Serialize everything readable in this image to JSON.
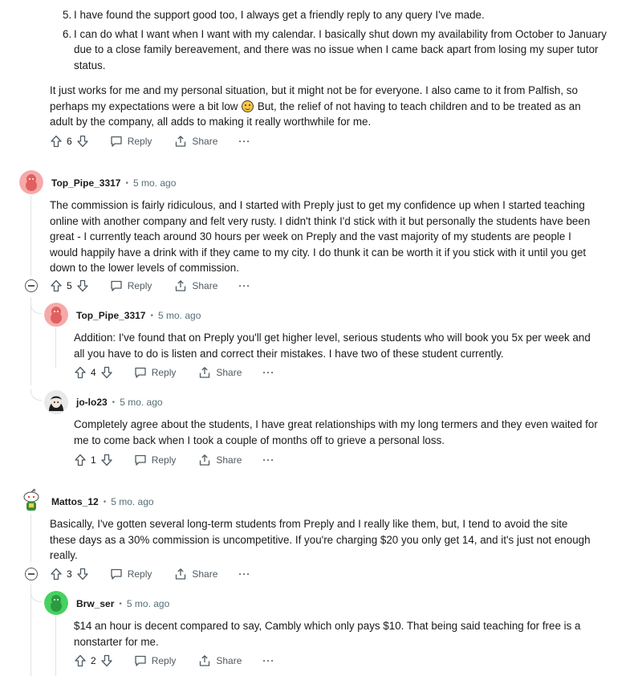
{
  "top_comment": {
    "list_items": [
      {
        "num": "5.",
        "text": "I have found the support good too, I always get a friendly reply to any query I've made."
      },
      {
        "num": "6.",
        "text": "I can do what I want when I want with my calendar. I basically shut down my availability from October to January due to a close family bereavement, and there was no issue when I came back apart from losing my super tutor status."
      }
    ],
    "para_before_emoji": "It just works for me and my personal situation, but it might not be for everyone. I also came to it from Palfish, so perhaps my expectations were a bit low ",
    "emoji_icon": "smiling-face-emoji",
    "para_after_emoji": " But, the relief of not having to teach children and to be treated as an adult by the company, all adds to making it really worthwhile for me.",
    "votes": "6"
  },
  "labels": {
    "reply": "Reply",
    "share": "Share",
    "more": "···",
    "separator": "•"
  },
  "comments": [
    {
      "author": "Top_Pipe_3317",
      "time": "5 mo. ago",
      "avatar_color": "#f08b8b",
      "text": "The commission is fairly ridiculous, and I started with Preply just to get my confidence up when I started teaching online with another company and felt very rusty. I didn't think I'd stick with it but personally the students have been great - I currently teach around 30 hours per week on Preply and the vast majority of my students are people I would happily have a drink with if they came to my city. I do thunk it can be worth it if you stick with it until you get down to the lower levels of commission.",
      "votes": "5"
    },
    {
      "author": "Top_Pipe_3317",
      "time": "5 mo. ago",
      "avatar_color": "#f08b8b",
      "text": "Addition: I've found that on Preply you'll get higher level, serious students who will book you 5x per week and all you have to do is listen and correct their mistakes. I have two of these student currently.",
      "votes": "4"
    },
    {
      "author": "jo-lo23",
      "time": "5 mo. ago",
      "avatar_color": "#222222",
      "text": "Completely agree about the students, I have great relationships with my long termers and they even waited for me to come back when I took a couple of months off to grieve a personal loss.",
      "votes": "1"
    },
    {
      "author": "Mattos_12",
      "time": "5 mo. ago",
      "avatar_color": "#ffffff",
      "text": "Basically, I've gotten several long-term students from Preply and I really like them, but, I tend to avoid the site these days as a 30% commission is uncompetitive. If you're charging $20 you only get 14, and it's just not enough really.",
      "votes": "3"
    },
    {
      "author": "Brw_ser",
      "time": "5 mo. ago",
      "avatar_color": "#46d160",
      "text": "$14 an hour is decent compared to say, Cambly which only pays $10. That being said teaching for free is a nonstarter for me.",
      "votes": "2"
    }
  ]
}
